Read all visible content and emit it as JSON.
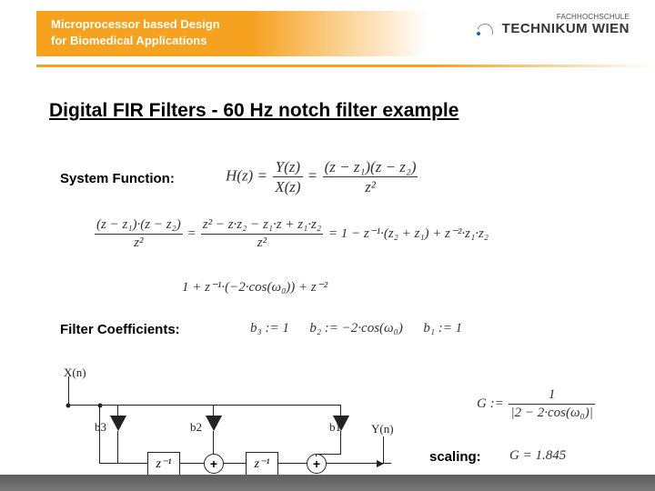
{
  "header": {
    "line1": "Microprocessor based Design",
    "line2": "for Biomedical Applications",
    "logo_small": "FACHHOCHSCHULE",
    "logo_big": "TECHNIKUM WIEN"
  },
  "title": "Digital FIR Filters  -  60 Hz notch filter example",
  "labels": {
    "system_function": "System Function:",
    "filter_coefficients": "Filter Coefficients:",
    "scaling": "scaling:"
  },
  "equations": {
    "H_lhs": "H(z) =",
    "H_mid_n": "Y(z)",
    "H_mid_d": "X(z)",
    "H_rhs_n": "(z − z₁)(z − z₂)",
    "H_rhs_d": "z²",
    "expand_lhs_n": "(z − z₁)·(z − z₂)",
    "expand_lhs_d": "z²",
    "expand_mid_n": "z² − z·z₂ − z₁·z + z₁·z₂",
    "expand_mid_d": "z²",
    "expand_rhs": "= 1 − z⁻¹·(z₂ + z₁) + z⁻²·z₁·z₂",
    "simpl": "1 + z⁻¹·(−2·cos(ω₀)) + z⁻²",
    "b3": "b₃ := 1",
    "b2": "b₂ := −2·cos(ω₀)",
    "b1": "b₁ := 1",
    "G_lhs": "G :=",
    "G_n": "1",
    "G_d": "|2 − 2·cos(ω₀)|",
    "G_val": "G = 1.845"
  },
  "diagram": {
    "x": "X(n)",
    "y": "Y(n)",
    "b3": "b3",
    "b2": "b2",
    "b1": "b1",
    "z": "z⁻¹",
    "sum": "+"
  }
}
